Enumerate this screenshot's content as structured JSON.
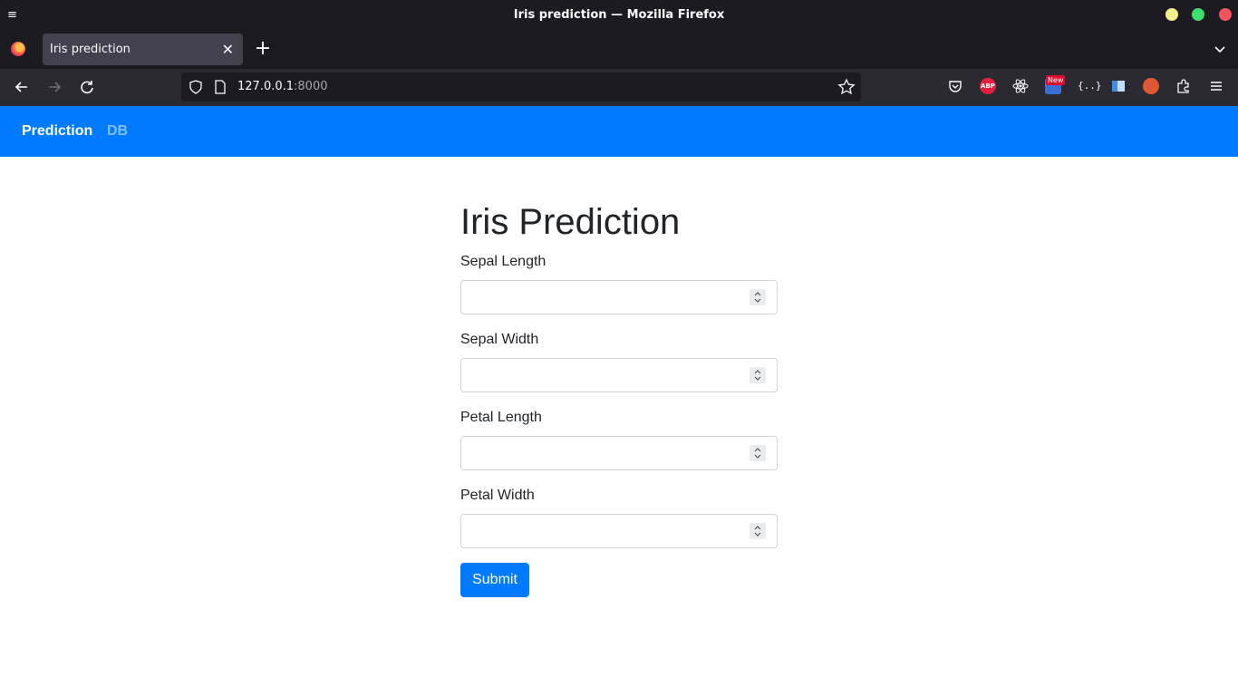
{
  "window": {
    "title": "Iris prediction — Mozilla Firefox",
    "menu_icon": "hamburger-icon",
    "controls": [
      "minimize",
      "maximize",
      "close"
    ]
  },
  "tabs": [
    {
      "title": "Iris prediction",
      "active": true
    }
  ],
  "toolbar": {
    "url_host": "127.0.0.1",
    "url_port": ":8000",
    "extensions": [
      "pocket",
      "adblock-plus",
      "react-devtools",
      "ext-new",
      "json-viewer",
      "sidebar",
      "duckduckgo",
      "extensions"
    ],
    "abp_label": "ABP",
    "new_badge": "New",
    "json_label": "{..}"
  },
  "site": {
    "nav": {
      "active": "Prediction",
      "other": "DB"
    },
    "heading": "Iris Prediction",
    "fields": [
      {
        "label": "Sepal Length",
        "value": ""
      },
      {
        "label": "Sepal Width",
        "value": ""
      },
      {
        "label": "Petal Length",
        "value": ""
      },
      {
        "label": "Petal Width",
        "value": ""
      }
    ],
    "submit_label": "Submit"
  },
  "colors": {
    "brand": "#007bff",
    "browser_chrome": "#1c1b22",
    "toolbar": "#2b2a33"
  }
}
